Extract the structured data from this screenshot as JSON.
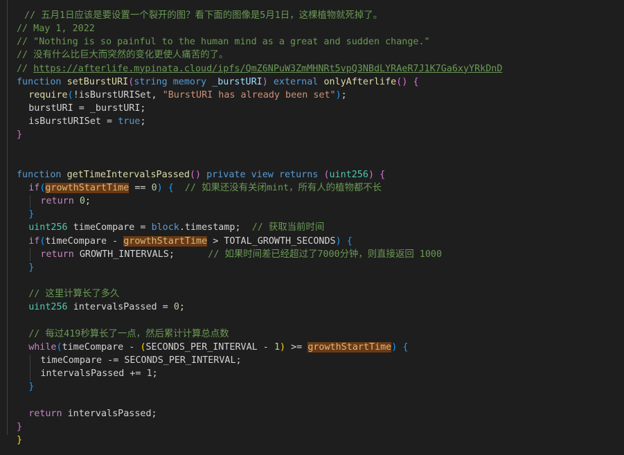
{
  "lines": [
    {
      "indent": "",
      "tokens": [
        {
          "t": " // 五月1日应该是要设置一个裂开的图？看下面的图像是5月1日，这棵植物就死掉了。",
          "c": "comment"
        }
      ]
    },
    {
      "indent": "",
      "tokens": [
        {
          "t": "// May 1, 2022",
          "c": "comment"
        }
      ]
    },
    {
      "indent": "",
      "tokens": [
        {
          "t": "// \"Nothing is so painful to the human mind as a great and sudden change.\"",
          "c": "comment"
        }
      ]
    },
    {
      "indent": "",
      "tokens": [
        {
          "t": "// 没有什么比巨大而突然的变化更使人痛苦的了。",
          "c": "comment"
        }
      ]
    },
    {
      "indent": "",
      "tokens": [
        {
          "t": "// ",
          "c": "comment"
        },
        {
          "t": "https://afterlife.mypinata.cloud/ipfs/QmZ6NPuW3ZmMHNRt5vpQ3NBdLYRAeR7J1K7Ga6xyYRkDnD",
          "c": "link"
        }
      ]
    },
    {
      "indent": "",
      "tokens": [
        {
          "t": "function ",
          "c": "kw"
        },
        {
          "t": "setBurstURI",
          "c": "fn"
        },
        {
          "t": "(",
          "c": "b2"
        },
        {
          "t": "string ",
          "c": "kw"
        },
        {
          "t": "memory ",
          "c": "kw"
        },
        {
          "t": "_burstURI",
          "c": "var"
        },
        {
          "t": ") ",
          "c": "b2"
        },
        {
          "t": "external ",
          "c": "kw"
        },
        {
          "t": "onlyAfterlife",
          "c": "fn"
        },
        {
          "t": "() ",
          "c": "b2"
        },
        {
          "t": "{",
          "c": "b2"
        }
      ]
    },
    {
      "indent": "  ",
      "tokens": [
        {
          "t": "require",
          "c": "fn"
        },
        {
          "t": "(",
          "c": "b3"
        },
        {
          "t": "!isBurstURISet, ",
          "c": "plain"
        },
        {
          "t": "\"BurstURI has already been set\"",
          "c": "str"
        },
        {
          "t": ")",
          "c": "b3"
        },
        {
          "t": ";",
          "c": "plain"
        }
      ]
    },
    {
      "indent": "  ",
      "tokens": [
        {
          "t": "burstURI = _burstURI;",
          "c": "plain"
        }
      ]
    },
    {
      "indent": "  ",
      "tokens": [
        {
          "t": "isBurstURISet = ",
          "c": "plain"
        },
        {
          "t": "true",
          "c": "kw"
        },
        {
          "t": ";",
          "c": "plain"
        }
      ]
    },
    {
      "indent": "",
      "tokens": [
        {
          "t": "}",
          "c": "b2"
        }
      ]
    },
    {
      "indent": "",
      "tokens": []
    },
    {
      "indent": "",
      "tokens": []
    },
    {
      "indent": "",
      "tokens": [
        {
          "t": "function ",
          "c": "kw"
        },
        {
          "t": "getTimeIntervalsPassed",
          "c": "fn"
        },
        {
          "t": "() ",
          "c": "b2"
        },
        {
          "t": "private ",
          "c": "kw"
        },
        {
          "t": "view ",
          "c": "kw"
        },
        {
          "t": "returns ",
          "c": "kw"
        },
        {
          "t": "(",
          "c": "b2"
        },
        {
          "t": "uint256",
          "c": "ty"
        },
        {
          "t": ") ",
          "c": "b2"
        },
        {
          "t": "{",
          "c": "b2"
        }
      ]
    },
    {
      "indent": "  ",
      "tokens": [
        {
          "t": "if",
          "c": "ctl"
        },
        {
          "t": "(",
          "c": "b3"
        },
        {
          "t": "growthStartTime",
          "c": "hl"
        },
        {
          "t": " == ",
          "c": "plain"
        },
        {
          "t": "0",
          "c": "num"
        },
        {
          "t": ") ",
          "c": "b3"
        },
        {
          "t": "{",
          "c": "b3"
        },
        {
          "t": "  // 如果还没有关闭mint，所有人的植物都不长",
          "c": "comment"
        }
      ]
    },
    {
      "indent": "    ",
      "tokens": [
        {
          "t": "return ",
          "c": "ctl"
        },
        {
          "t": "0",
          "c": "num"
        },
        {
          "t": ";",
          "c": "plain"
        }
      ]
    },
    {
      "indent": "  ",
      "tokens": [
        {
          "t": "}",
          "c": "b3"
        }
      ]
    },
    {
      "indent": "  ",
      "tokens": [
        {
          "t": "uint256 ",
          "c": "ty"
        },
        {
          "t": "timeCompare = ",
          "c": "plain"
        },
        {
          "t": "block",
          "c": "kw"
        },
        {
          "t": ".timestamp;  ",
          "c": "plain"
        },
        {
          "t": "// 获取当前时间",
          "c": "comment"
        }
      ]
    },
    {
      "indent": "  ",
      "tokens": [
        {
          "t": "if",
          "c": "ctl"
        },
        {
          "t": "(",
          "c": "b3"
        },
        {
          "t": "timeCompare - ",
          "c": "plain"
        },
        {
          "t": "growthStartTime",
          "c": "hl"
        },
        {
          "t": " > TOTAL_GROWTH_SECONDS",
          "c": "plain"
        },
        {
          "t": ") ",
          "c": "b3"
        },
        {
          "t": "{",
          "c": "b3"
        }
      ]
    },
    {
      "indent": "    ",
      "tokens": [
        {
          "t": "return ",
          "c": "ctl"
        },
        {
          "t": "GROWTH_INTERVALS;      ",
          "c": "plain"
        },
        {
          "t": "// 如果时间差已经超过了7000分钟，则直接返回 1000",
          "c": "comment"
        }
      ]
    },
    {
      "indent": "  ",
      "tokens": [
        {
          "t": "}",
          "c": "b3"
        }
      ]
    },
    {
      "indent": "",
      "tokens": []
    },
    {
      "indent": "  ",
      "tokens": [
        {
          "t": "// 这里计算长了多久",
          "c": "comment"
        }
      ]
    },
    {
      "indent": "  ",
      "tokens": [
        {
          "t": "uint256 ",
          "c": "ty"
        },
        {
          "t": "intervalsPassed = ",
          "c": "plain"
        },
        {
          "t": "0",
          "c": "num"
        },
        {
          "t": ";",
          "c": "plain"
        }
      ]
    },
    {
      "indent": "",
      "tokens": []
    },
    {
      "indent": "  ",
      "tokens": [
        {
          "t": "// 每过419秒算长了一点，然后累计计算总点数",
          "c": "comment"
        }
      ]
    },
    {
      "indent": "  ",
      "tokens": [
        {
          "t": "while",
          "c": "ctl"
        },
        {
          "t": "(",
          "c": "b3"
        },
        {
          "t": "timeCompare - ",
          "c": "plain"
        },
        {
          "t": "(",
          "c": "b1"
        },
        {
          "t": "SECONDS_PER_INTERVAL - ",
          "c": "plain"
        },
        {
          "t": "1",
          "c": "num"
        },
        {
          "t": ") ",
          "c": "b1"
        },
        {
          "t": ">= ",
          "c": "plain"
        },
        {
          "t": "growthStartTime",
          "c": "hl"
        },
        {
          "t": ") ",
          "c": "b3"
        },
        {
          "t": "{",
          "c": "b3"
        }
      ]
    },
    {
      "indent": "    ",
      "tokens": [
        {
          "t": "timeCompare -= SECONDS_PER_INTERVAL;",
          "c": "plain"
        }
      ]
    },
    {
      "indent": "    ",
      "tokens": [
        {
          "t": "intervalsPassed += ",
          "c": "plain"
        },
        {
          "t": "1",
          "c": "num"
        },
        {
          "t": ";",
          "c": "plain"
        }
      ]
    },
    {
      "indent": "  ",
      "tokens": [
        {
          "t": "}",
          "c": "b3"
        }
      ]
    },
    {
      "indent": "",
      "tokens": []
    },
    {
      "indent": "  ",
      "tokens": [
        {
          "t": "return ",
          "c": "ctl"
        },
        {
          "t": "intervalsPassed;",
          "c": "plain"
        }
      ]
    },
    {
      "indent": "",
      "tokens": [
        {
          "t": "}",
          "c": "b2"
        }
      ]
    },
    {
      "indent": "",
      "tokens": [
        {
          "t": "}",
          "c": "b1"
        }
      ]
    }
  ]
}
